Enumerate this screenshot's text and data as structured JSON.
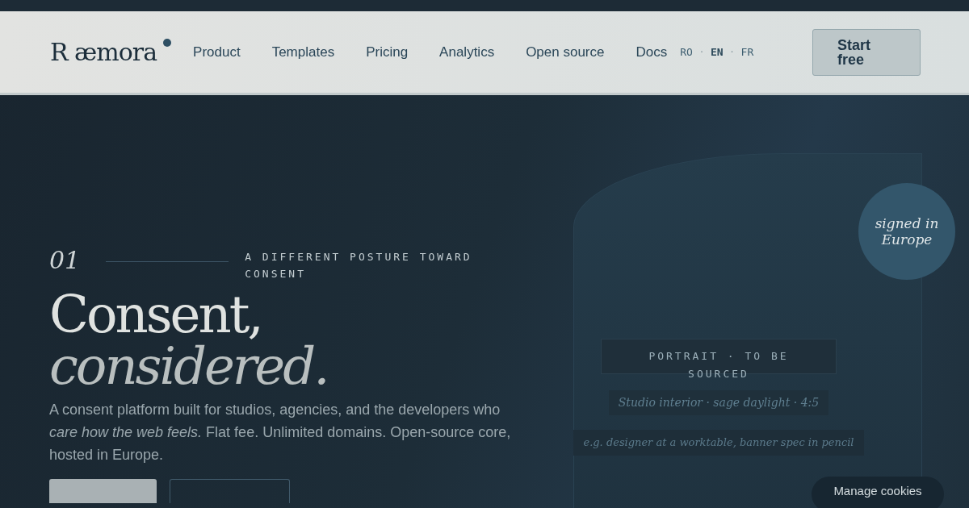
{
  "brand": {
    "name": "R æmora"
  },
  "nav": {
    "links": [
      "Product",
      "Templates",
      "Pricing",
      "Analytics",
      "Open source",
      "Docs"
    ],
    "languages": [
      {
        "label": "RO",
        "selected": false
      },
      {
        "label": "EN",
        "selected": true
      },
      {
        "label": "FR",
        "selected": false
      }
    ],
    "language_separator": "·",
    "cta": "Start free"
  },
  "hero": {
    "index": "01",
    "eyebrow": "A DIFFERENT POSTURE TOWARD CONSENT",
    "title_line_1": "Consent,",
    "title_line_2": "considered.",
    "lead": "A consent platform built for studios, agencies, and the developers who *care how the web feels.* Flat fee. Unlimited domains. Open-source core, hosted in Europe."
  },
  "portrait": {
    "badge": "signed in Europe",
    "label": "PORTRAIT · TO BE SOURCED",
    "caption": "Studio interior · sage daylight · 4:5",
    "note": "e.g. designer at a worktable, banner spec in pencil"
  },
  "cookies_button": "Manage cookies"
}
